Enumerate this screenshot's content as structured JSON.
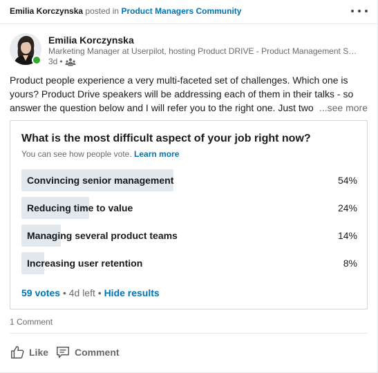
{
  "header": {
    "actor": "Emilia Korczynska",
    "posted_in_text": " posted in ",
    "group": "Product Managers Community"
  },
  "author": {
    "name": "Emilia Korczynska",
    "headline": "Marketing Manager at Userpilot, hosting Product DRIVE - Product Management Summit",
    "time": "3d",
    "separator": "•",
    "visibility_icon": "group-icon",
    "online_status_color": "#3aa531"
  },
  "post": {
    "text": "Product people experience a very multi-faceted set of challenges. Which one is yours? Product Drive speakers will be addressing each of them in their talks - so answer the question below and I will refer you to the right one. Just two",
    "see_more": "...see more"
  },
  "poll": {
    "question": "What is the most difficult aspect of your job right now?",
    "note": "You can see how people vote.",
    "learn_more": "Learn more",
    "options": [
      {
        "label": "Convincing senior management",
        "percent_text": "54%",
        "percent": 54
      },
      {
        "label": "Reducing time to value",
        "percent_text": "24%",
        "percent": 24
      },
      {
        "label": "Managing several product teams",
        "percent_text": "14%",
        "percent": 14
      },
      {
        "label": "Increasing user retention",
        "percent_text": "8%",
        "percent": 8
      }
    ],
    "votes": "59 votes",
    "separator": "•",
    "time_left": "4d left",
    "hide_results": "Hide results",
    "bar_color": "#e1e9ee",
    "link_color": "#0073b1"
  },
  "social": {
    "comment_count": "1 Comment"
  },
  "actions": {
    "like": "Like",
    "comment": "Comment"
  }
}
